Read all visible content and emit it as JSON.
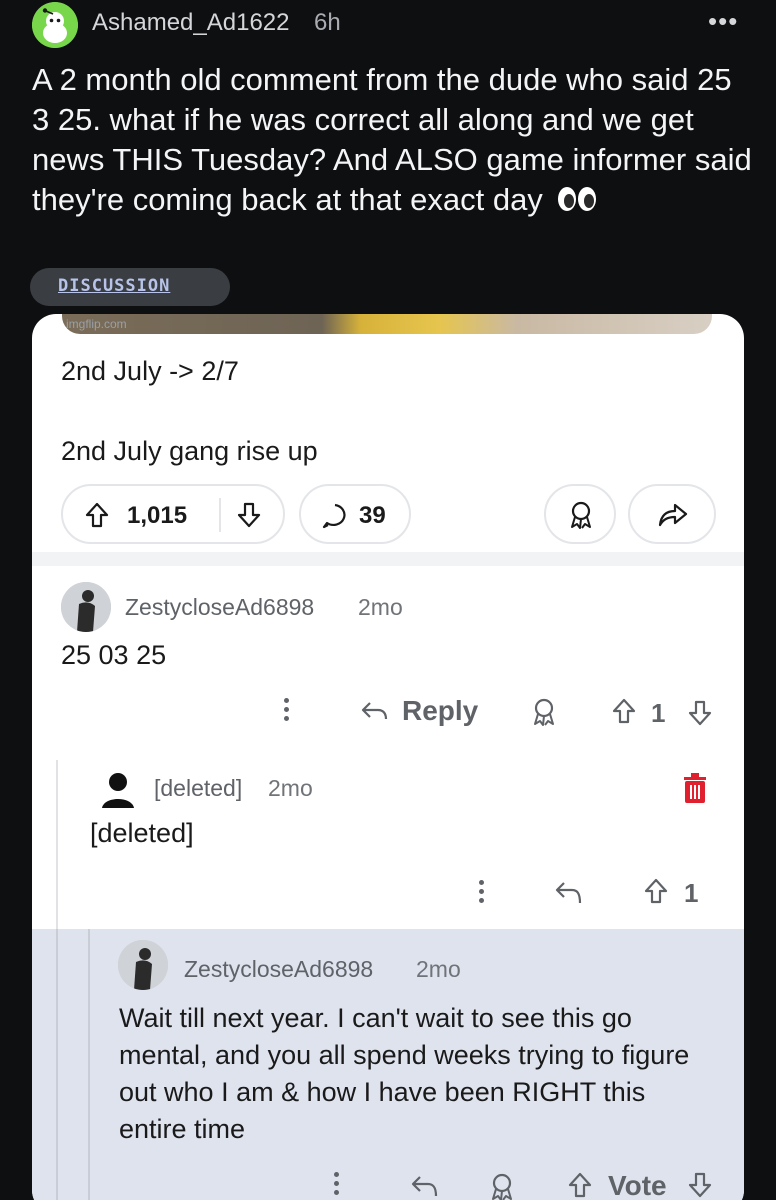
{
  "post": {
    "username": "Ashamed_Ad1622",
    "time": "6h",
    "more": "•••",
    "title": "A 2 month old comment from the dude who said 25 3 25. what if he was correct all along and we get news THIS Tuesday? And ALSO game informer said they're coming back at that exact day",
    "flair": "DISCUSSION"
  },
  "screenshot": {
    "watermark": "imgflip.com",
    "comment_line1": "2nd July -> 2/7",
    "comment_line2": "2nd July gang rise up",
    "upvotes": "1,015",
    "comments": "39",
    "replies": [
      {
        "username": "ZestycloseAd6898",
        "time": "2mo",
        "text": "25 03 25",
        "reply_label": "Reply",
        "score": "1"
      },
      {
        "username": "[deleted]",
        "time": "2mo",
        "text": "[deleted]",
        "score": "1"
      },
      {
        "username": "ZestycloseAd6898",
        "time": "2mo",
        "text": "Wait till next year. I can't wait to see this go mental, and you all spend weeks trying to figure out who I am & how I have been RIGHT this entire time",
        "vote_label": "Vote"
      }
    ]
  },
  "colors": {
    "background": "#0e0f11",
    "card": "#ffffff",
    "highlight": "#dfe3ee",
    "delete_red": "#e0202e",
    "avatar_green": "#78d64b"
  }
}
